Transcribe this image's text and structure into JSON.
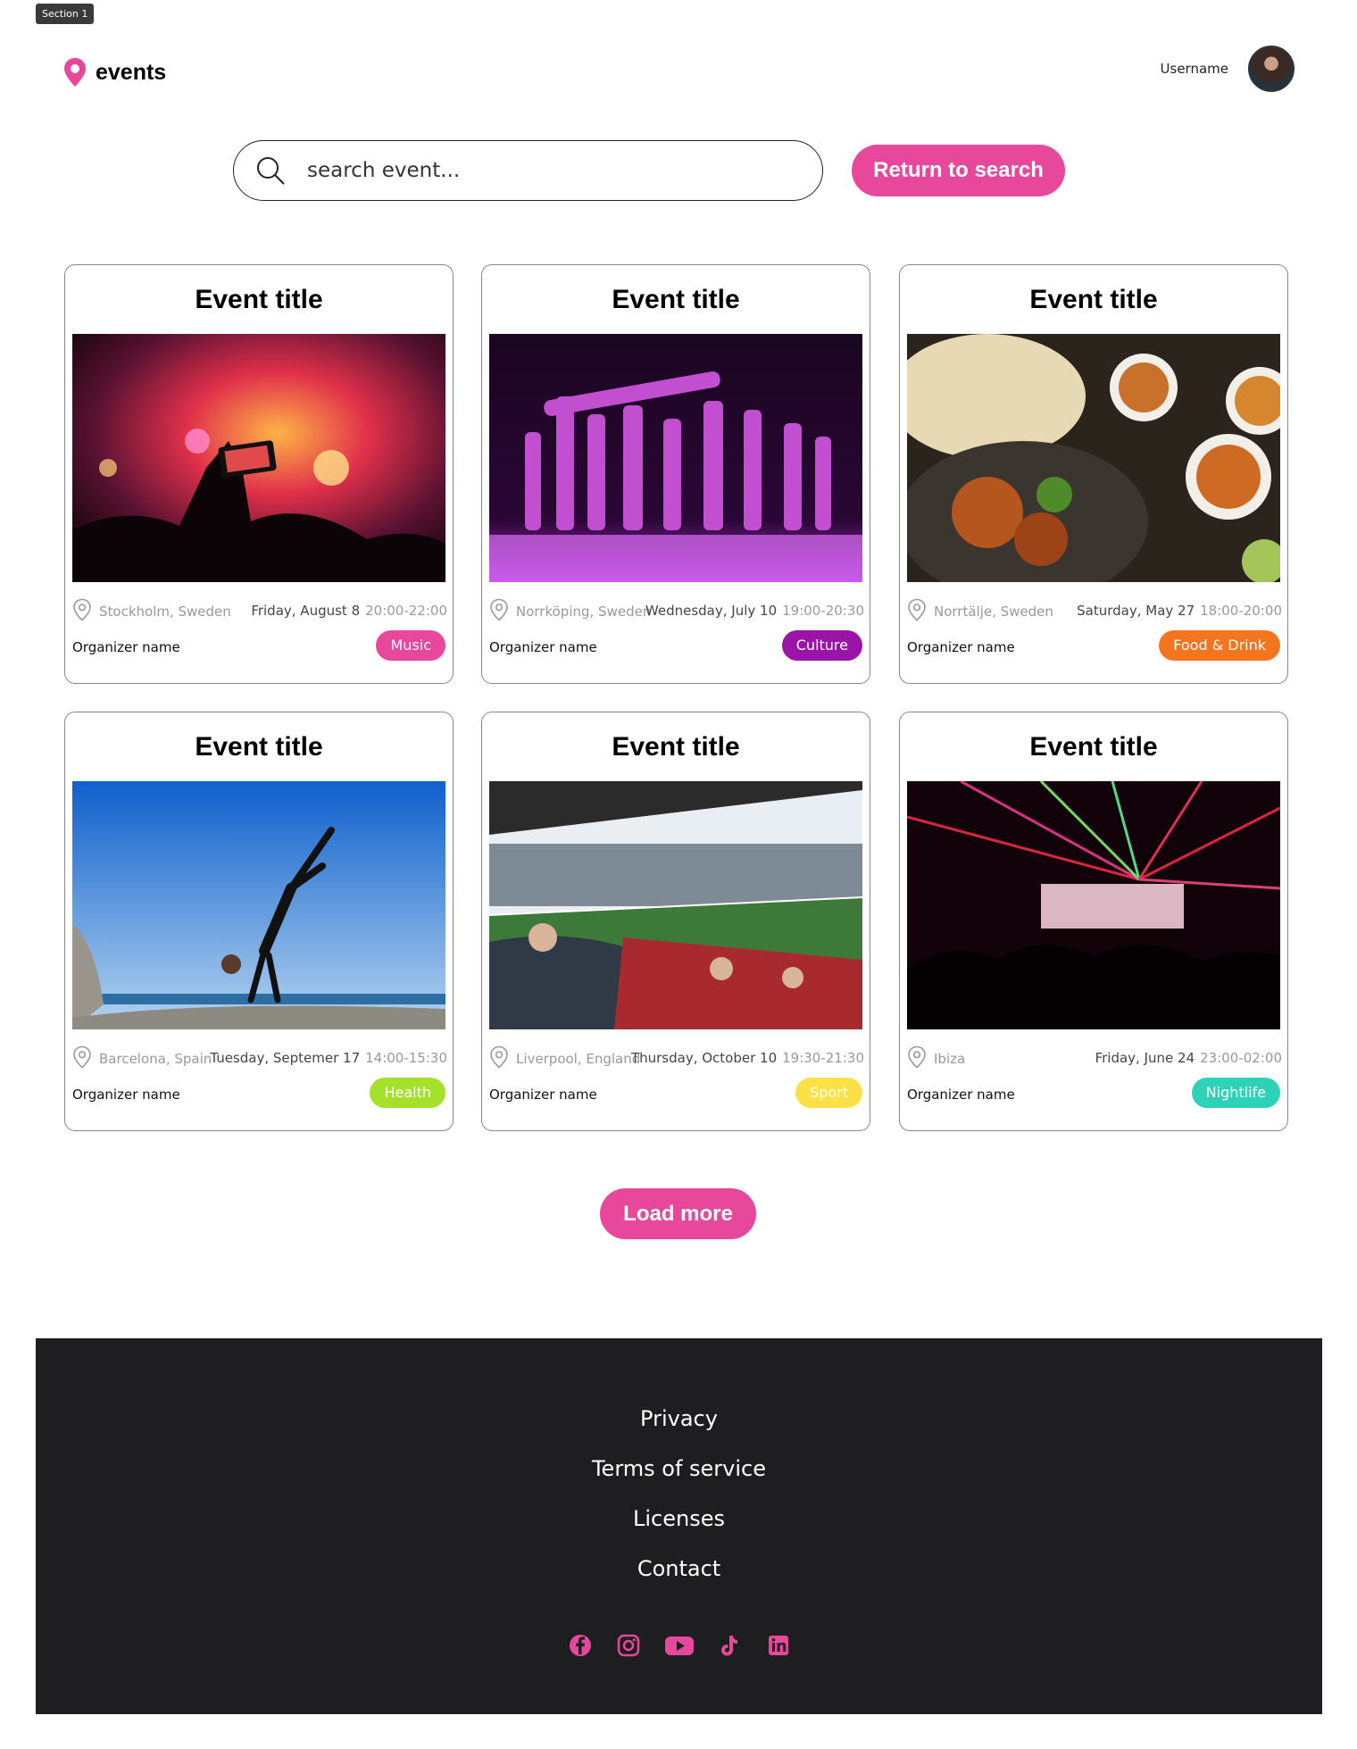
{
  "section_tag": "Section 1",
  "header": {
    "logo_text": "events",
    "username": "Username"
  },
  "search": {
    "placeholder": "search event...",
    "return_label": "Return to search"
  },
  "events": [
    {
      "title": "Event title",
      "location": "Stockholm, Sweden",
      "date": "Friday, August 8",
      "time": "20:00-22:00",
      "organizer": "Organizer name",
      "category": "Music",
      "category_color": "#e8489b",
      "image": "concert"
    },
    {
      "title": "Event title",
      "location": "Norrköping, Sweden",
      "date": "Wednesday, July 10",
      "time": "19:00-20:30",
      "organizer": "Organizer name",
      "category": "Culture",
      "category_color": "#9b14a8",
      "image": "dance"
    },
    {
      "title": "Event title",
      "location": "Norrtälje, Sweden",
      "date": "Saturday, May 27",
      "time": "18:00-20:00",
      "organizer": "Organizer name",
      "category": "Food & Drink",
      "category_color": "#f5751f",
      "image": "food"
    },
    {
      "title": "Event title",
      "location": "Barcelona, Spain",
      "date": "Tuesday, Septemer 17",
      "time": "14:00-15:30",
      "organizer": "Organizer name",
      "category": "Health",
      "category_color": "#a5e02a",
      "image": "yoga"
    },
    {
      "title": "Event title",
      "location": "Liverpool, England",
      "date": "Thursday, October 10",
      "time": "19:30-21:30",
      "organizer": "Organizer name",
      "category": "Sport",
      "category_color": "#fce146",
      "image": "stadium"
    },
    {
      "title": "Event title",
      "location": "Ibiza",
      "date": "Friday, June 24",
      "time": "23:00-02:00",
      "organizer": "Organizer name",
      "category": "Nightlife",
      "category_color": "#2ed3b7",
      "image": "club"
    }
  ],
  "load_more_label": "Load more",
  "footer": {
    "links": [
      "Privacy",
      "Terms of service",
      "Licenses",
      "Contact"
    ],
    "socials": [
      "facebook-icon",
      "instagram-icon",
      "youtube-icon",
      "tiktok-icon",
      "linkedin-icon"
    ]
  },
  "colors": {
    "accent": "#e8489b",
    "footer_bg": "#1e1e20"
  }
}
